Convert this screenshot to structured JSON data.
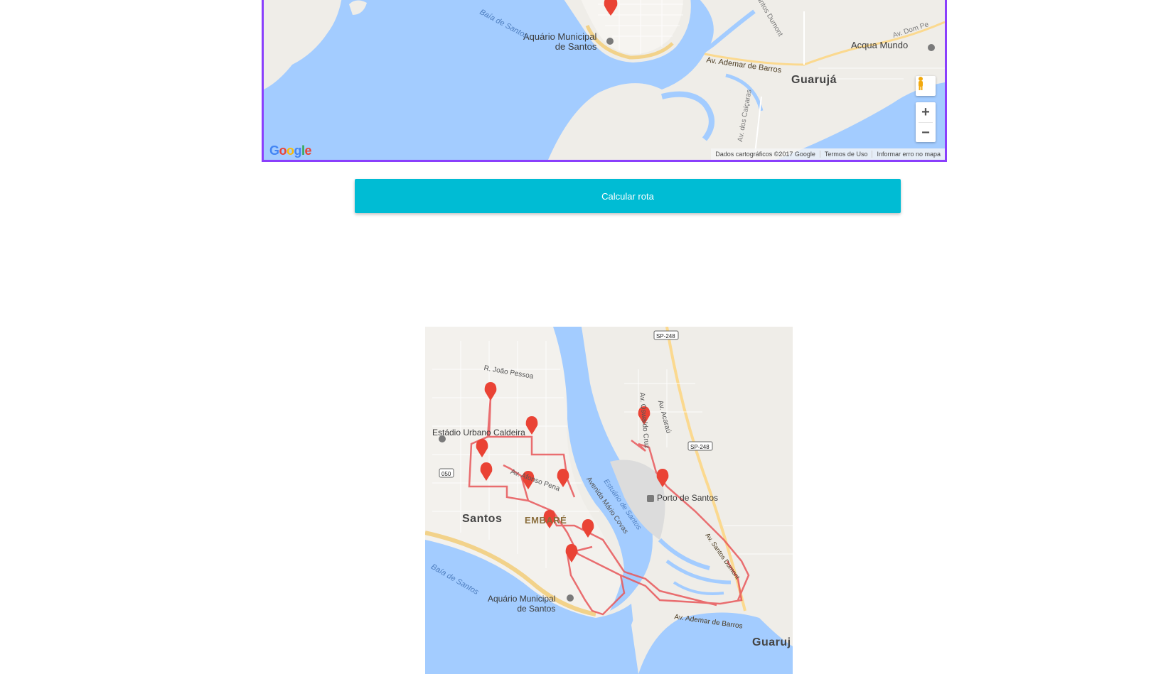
{
  "top_map": {
    "labels": {
      "aquario": "Aquário Municipal\nde Santos",
      "baia": "Baía de Santos",
      "av_ademar": "Av. Ademar de Barros",
      "guaruja": "Guarujá",
      "acqua": "Acqua Mundo",
      "av_dom_pedro": "Av. Dom Pe",
      "santos_dumont": "Santos Dumont",
      "av_caicaras": "Av. dos Caiçaras"
    },
    "google_logo": "Google",
    "attribution": {
      "data": "Dados cartográficos ©2017 Google",
      "terms": "Termos de Uso",
      "report": "Informar erro no mapa"
    },
    "zoom_in": "+",
    "zoom_out": "−"
  },
  "calc_button": "Calcular rota",
  "bottom_map": {
    "labels": {
      "sp248_a": "SP-248",
      "sp248_b": "SP-248",
      "joao_pessoa": "R. João Pessoa",
      "estadio": "Estádio Urbano Caldeira",
      "route050": "050",
      "santos": "Santos",
      "embare": "EMBARÉ",
      "afonso_pena": "Av. Afonso Pena",
      "mario_covas": "Avenida Mário Covas",
      "estuario": "Estuário de Santos",
      "oswaldo_cruz": "Av. Oswaldo Cruz",
      "acarau": "Av. Acaraú",
      "porto": "Porto de Santos",
      "santos_dumont": "Av. Santos Dumont",
      "ademar": "Av. Ademar de Barros",
      "guaruja": "Guaruj",
      "baia": "Baía de Santos",
      "aquario": "Aquário Municipal\nde Santos"
    }
  },
  "colors": {
    "button": "#00bcd4",
    "map_border": "#8a3ffc",
    "water": "#a3ccff",
    "route": "#e8575a"
  }
}
